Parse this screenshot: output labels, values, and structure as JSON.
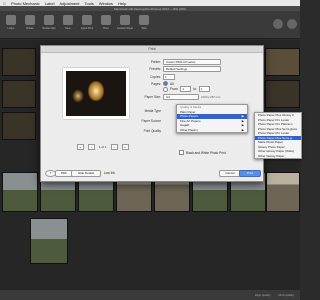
{
  "menubar": {
    "apple": "",
    "items": [
      "Photo Mechanic",
      "Label",
      "Adjustment",
      "Tools",
      "Window",
      "Help"
    ]
  },
  "titlebar": {
    "text": "Macintosh HD:Users:jpfoto:Pictures:2013:...JPG (300)"
  },
  "toolbar": {
    "buttons": [
      {
        "label": "Loupe",
        "icon": "loupe-icon"
      },
      {
        "label": "Rotate"
      },
      {
        "label": "Rotate right"
      },
      {
        "label": "Save"
      },
      {
        "label": "Quick Print"
      },
      {
        "label": "Burn"
      },
      {
        "label": "Contact Sheet"
      },
      {
        "label": "Web"
      }
    ]
  },
  "dialog": {
    "title": "Print",
    "printer_label": "Printer:",
    "printer_value": "Canon PRO-10 series",
    "presets_label": "Presets:",
    "presets_value": "Default Settings",
    "copies_label": "Copies:",
    "copies_value": "1",
    "pages_label": "Pages:",
    "pages_all": "All",
    "pages_from": "From:",
    "pages_from_value": "1",
    "pages_to": "to:",
    "pages_to_value": "1",
    "paper_size_label": "Paper Size:",
    "paper_size_value": "A4",
    "paper_size_dims": "210 by 297 mm",
    "media_type_label": "Media Type",
    "paper_source_label": "Paper Source",
    "print_quality_label": "Print Quality",
    "bw_print_label": "Black and White Photo Print",
    "pager_text": "1 of 1",
    "help_label": "?",
    "pdf_label": "PDF",
    "hide_details_label": "Hide Details",
    "low_ink_label": "Low Ink",
    "cancel_label": "Cancel",
    "print_label": "Print"
  },
  "media_menu": {
    "header": "Quality & Media",
    "items": [
      {
        "label": "Plain Paper",
        "highlight": false,
        "sub": false
      },
      {
        "label": "Photo Papers",
        "highlight": true,
        "sub": true
      },
      {
        "label": "Fine Art Papers",
        "highlight": false,
        "sub": true
      },
      {
        "label": "Hagaki",
        "highlight": false,
        "sub": true
      },
      {
        "label": "Other Papers",
        "highlight": false,
        "sub": true
      }
    ]
  },
  "photo_submenu": {
    "items": [
      {
        "label": "Photo Paper Plus Glossy II",
        "highlight": false
      },
      {
        "label": "Photo Paper Pro Luster",
        "highlight": false
      },
      {
        "label": "Photo Paper Pro Platinum",
        "highlight": false
      },
      {
        "label": "Photo Paper Plus Semi-gloss",
        "highlight": false
      },
      {
        "label": "Photo Paper Pro Luster",
        "highlight": false
      },
      {
        "label": "Photo Paper Plus Semi-g...",
        "highlight": true
      },
      {
        "label": "Matte Photo Paper",
        "highlight": false
      },
      {
        "label": "Glossy Photo Paper",
        "highlight": false
      },
      {
        "label": "Other Glossy Paper (Wide)",
        "highlight": false
      },
      {
        "label": "Other Glossy Paper",
        "highlight": false
      }
    ]
  },
  "status": {
    "left": "High quality",
    "right": "Rich quality"
  },
  "colors": {
    "accent": "#2f62d0",
    "print_button": "#5a8ee8"
  }
}
